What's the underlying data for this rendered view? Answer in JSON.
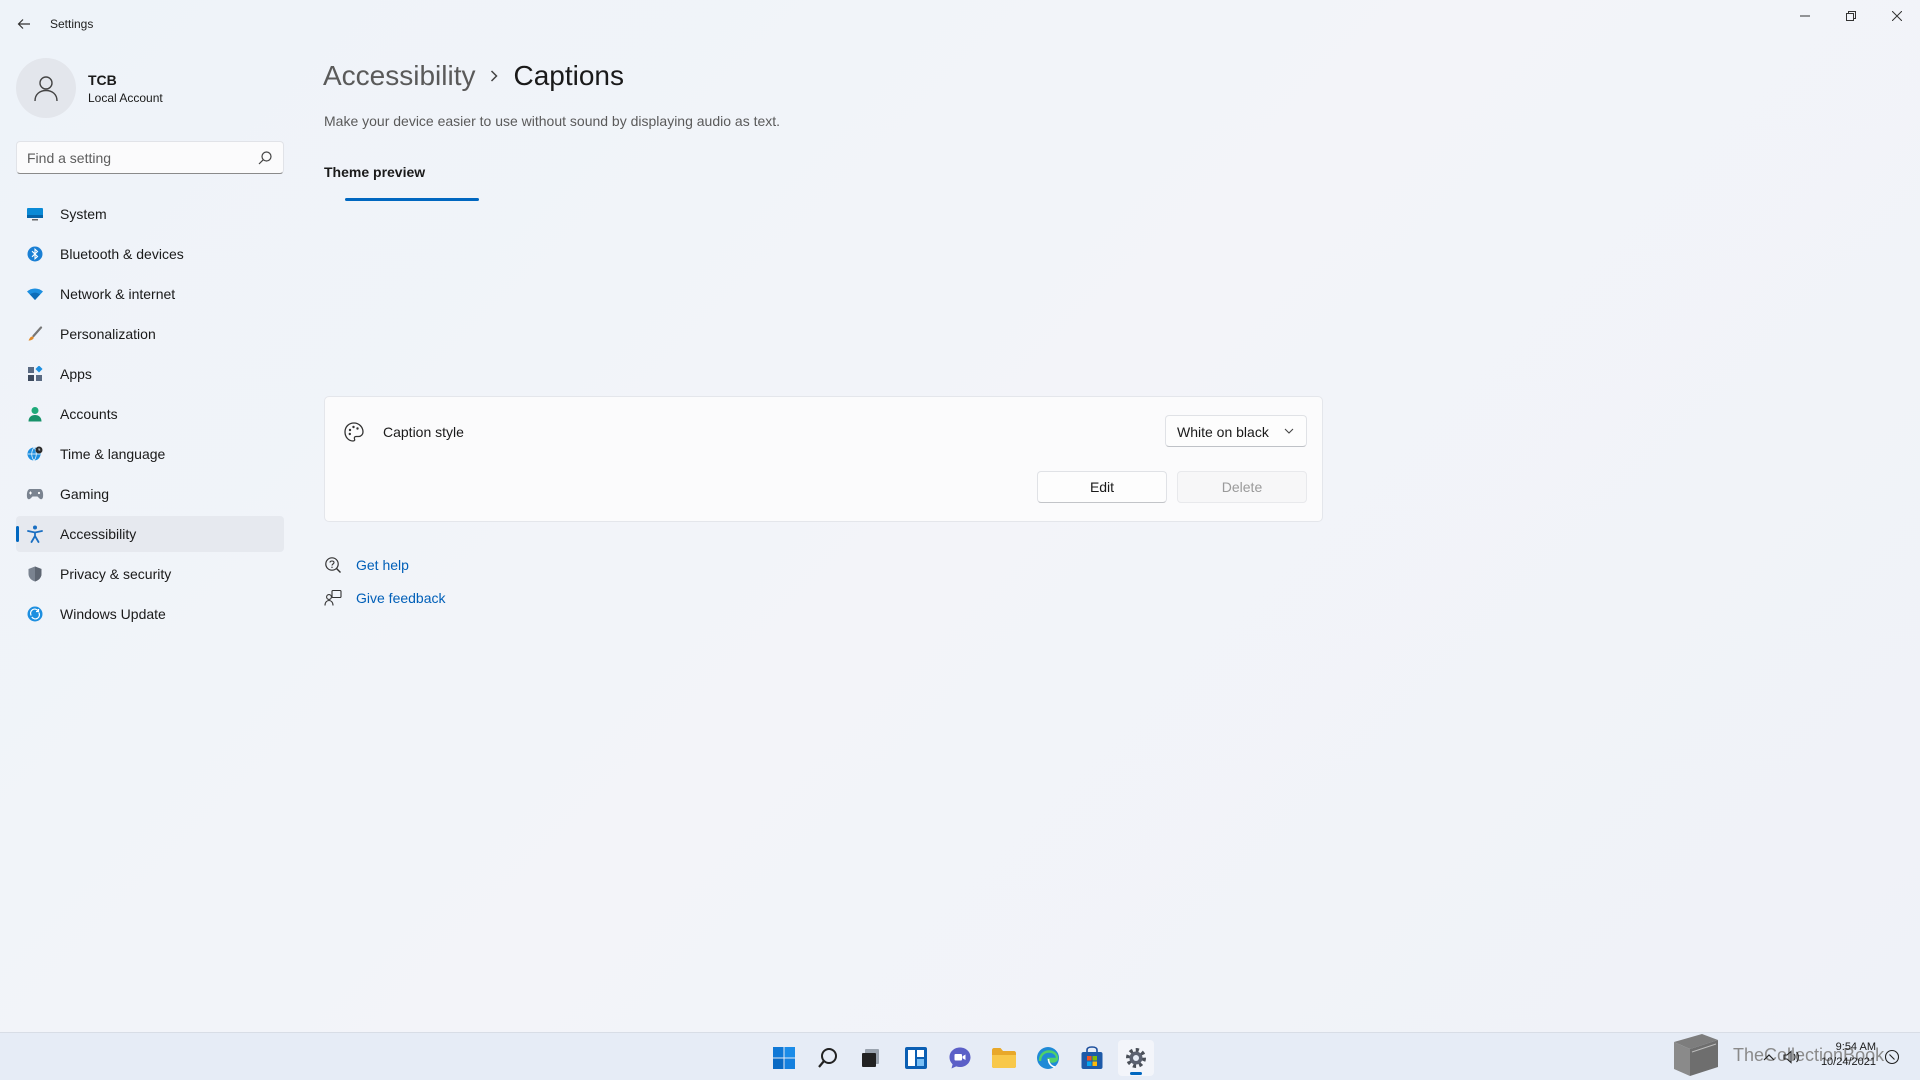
{
  "window": {
    "title": "Settings"
  },
  "profile": {
    "name": "TCB",
    "account_type": "Local Account"
  },
  "search": {
    "placeholder": "Find a setting"
  },
  "sidebar": {
    "items": [
      {
        "label": "System",
        "icon": "monitor-icon",
        "active": false
      },
      {
        "label": "Bluetooth & devices",
        "icon": "bluetooth-icon",
        "active": false
      },
      {
        "label": "Network & internet",
        "icon": "wifi-icon",
        "active": false
      },
      {
        "label": "Personalization",
        "icon": "brush-icon",
        "active": false
      },
      {
        "label": "Apps",
        "icon": "apps-icon",
        "active": false
      },
      {
        "label": "Accounts",
        "icon": "person-icon",
        "active": false
      },
      {
        "label": "Time & language",
        "icon": "globe-clock-icon",
        "active": false
      },
      {
        "label": "Gaming",
        "icon": "gamepad-icon",
        "active": false
      },
      {
        "label": "Accessibility",
        "icon": "accessibility-icon",
        "active": true
      },
      {
        "label": "Privacy & security",
        "icon": "shield-icon",
        "active": false
      },
      {
        "label": "Windows Update",
        "icon": "update-icon",
        "active": false
      }
    ]
  },
  "main": {
    "breadcrumb_parent": "Accessibility",
    "breadcrumb_current": "Captions",
    "description": "Make your device easier to use without sound by displaying audio as text.",
    "preview_title": "Theme preview",
    "caption_style": {
      "label": "Caption style",
      "selected": "White on black",
      "edit_label": "Edit",
      "delete_label": "Delete"
    },
    "links": {
      "help": "Get help",
      "feedback": "Give feedback"
    }
  },
  "taskbar": {
    "apps": [
      "start-icon",
      "search-icon",
      "task-view-icon",
      "widgets-icon",
      "chat-icon",
      "file-explorer-icon",
      "edge-icon",
      "store-icon",
      "settings-icon"
    ],
    "watermark": "TheCollectionBook",
    "time": "9:54 AM",
    "date": "10/24/2021"
  },
  "colors": {
    "accent": "#0067c0",
    "link": "#005fb8"
  }
}
